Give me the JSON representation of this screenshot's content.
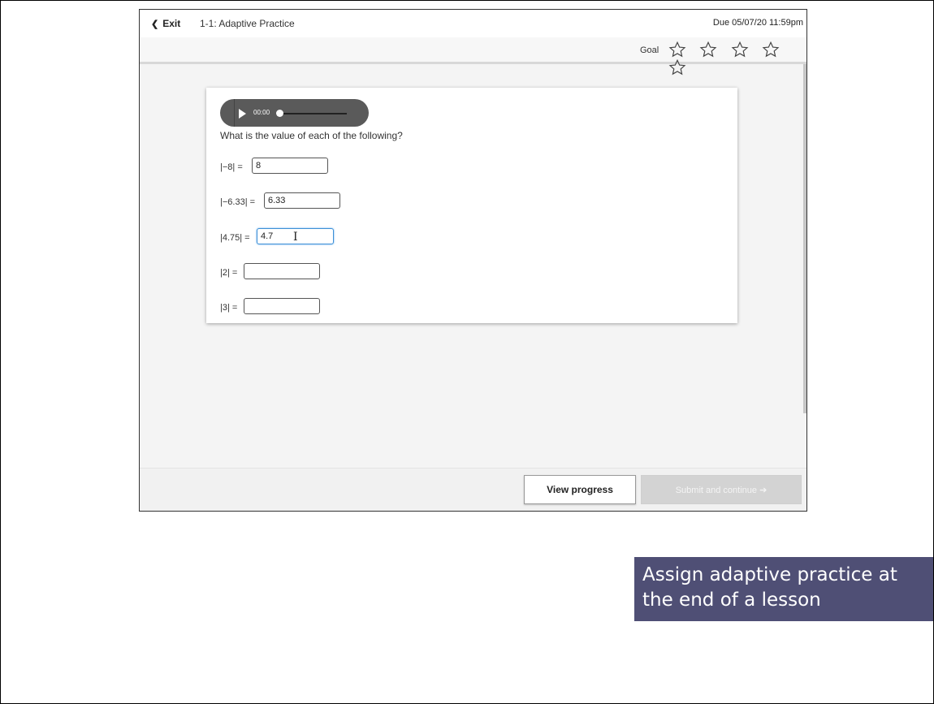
{
  "header": {
    "exit_label": "Exit",
    "title": "1-1: Adaptive Practice",
    "due": "Due 05/07/20 11:59pm"
  },
  "goal": {
    "label": "Goal",
    "stars_total": 5,
    "stars_filled": 0
  },
  "audio": {
    "time": "00:00"
  },
  "question": {
    "prompt": "What is the value of each of the following?",
    "items": [
      {
        "label": "|−8| =",
        "value": ""
      },
      {
        "label": "|−6.33| =",
        "value": ""
      },
      {
        "label": "|4.75| =",
        "value": ""
      },
      {
        "label": "|2| =",
        "value": ""
      },
      {
        "label": "|3| =",
        "value": ""
      }
    ],
    "values": [
      "8",
      "6.33",
      "4.7",
      "",
      ""
    ]
  },
  "footer": {
    "view_progress_label": "View progress",
    "submit_label": "Submit and continue ➔"
  },
  "caption": {
    "line1": "Assign adaptive practice at",
    "line2": "the end of a lesson"
  },
  "colors": {
    "caption_bg": "#4f4f75",
    "active_input_border": "#3d8fd6",
    "audio_bg": "#5a5a5a"
  }
}
